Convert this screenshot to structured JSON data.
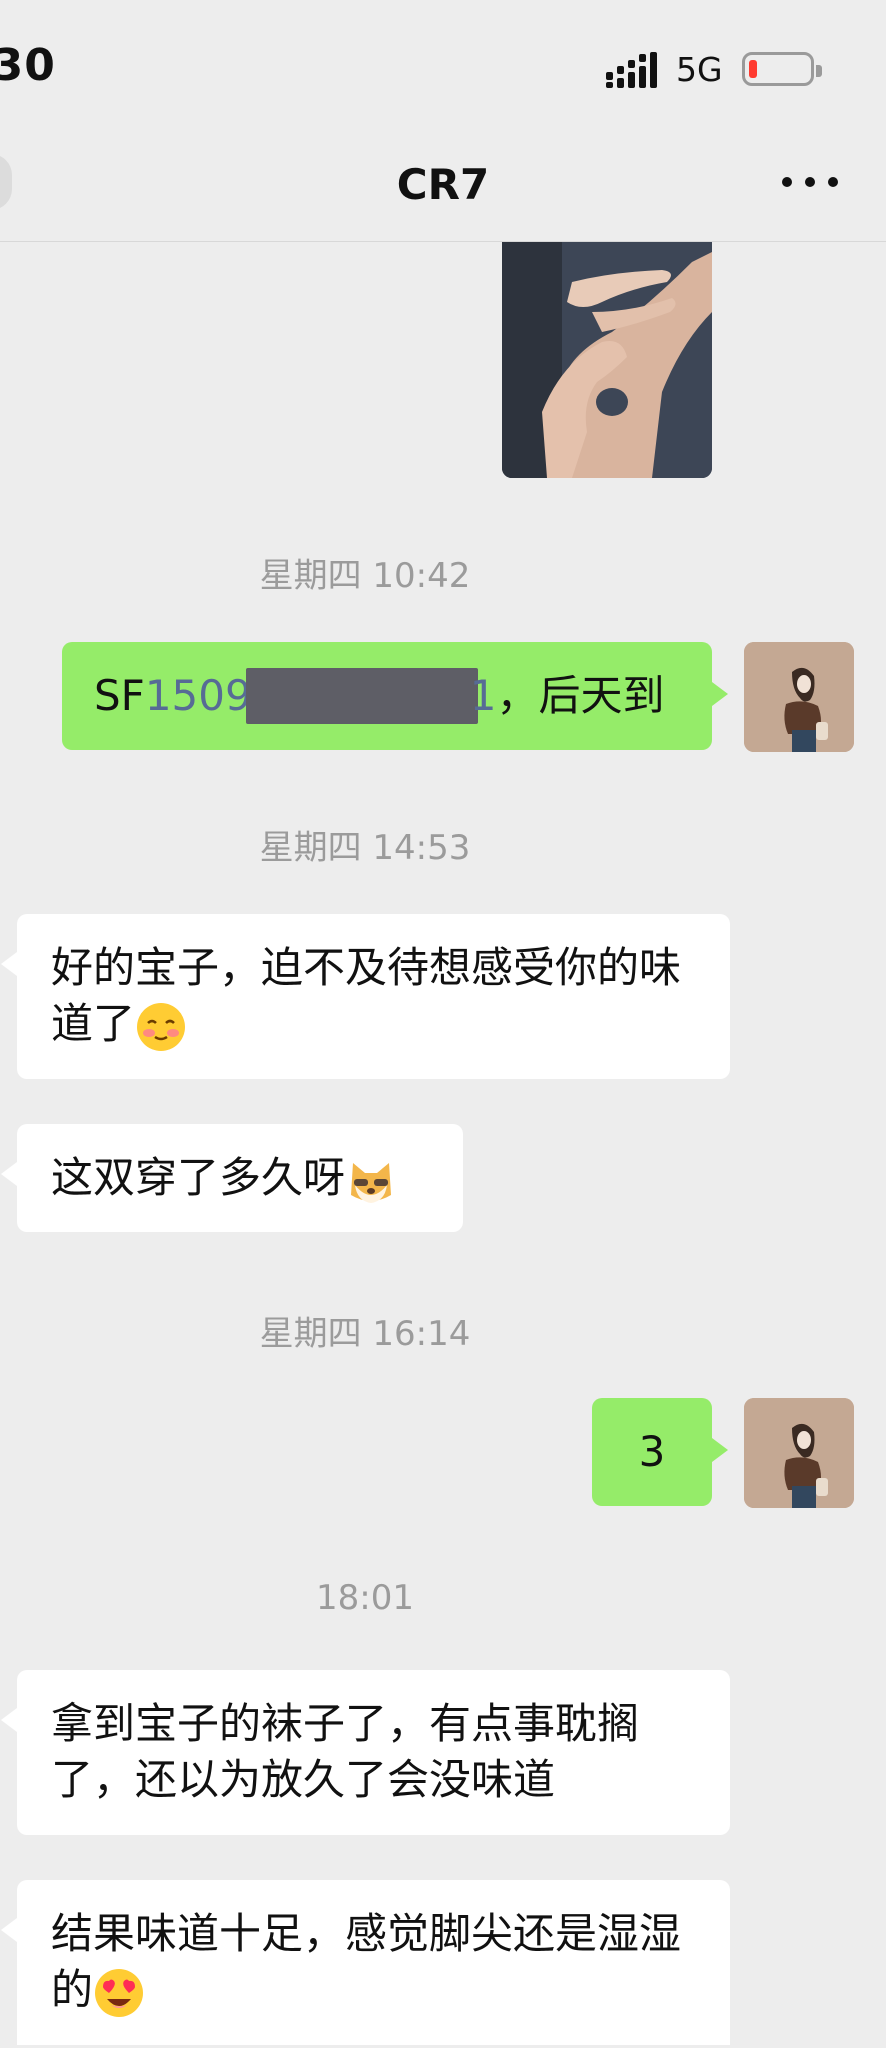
{
  "status_bar": {
    "time": ":30",
    "network": "5G",
    "battery_level_percent": 8,
    "battery_color": "#ff3b30"
  },
  "header": {
    "title": "CR7",
    "more_icon": "more-dots-icon"
  },
  "colors": {
    "background": "#ededed",
    "sent_bubble": "#95ec69",
    "received_bubble": "#ffffff",
    "timestamp_text": "#9b9b9b",
    "link_text": "#576b95"
  },
  "messages": {
    "ts1": "星期四 10:42",
    "m1": {
      "prefix": "SF",
      "number_visible_start": "1509",
      "number_visible_end": "1",
      "suffix": "，后天到"
    },
    "ts2": "星期四 14:53",
    "m2": {
      "text": "好的宝子，迫不及待想感受你的味道了",
      "emoji": "blushing-smile-emoji"
    },
    "m3": {
      "text": "这双穿了多久呀",
      "emoji": "doge-emoji"
    },
    "ts3": "星期四 16:14",
    "m4": {
      "text": "3"
    },
    "ts4": "18:01",
    "m5": {
      "text": "拿到宝子的袜子了，有点事耽搁了，还以为放久了会没味道"
    },
    "m6": {
      "text": "结果味道十足，感觉脚尖还是湿湿的",
      "emoji": "heart-eyes-emoji"
    }
  }
}
